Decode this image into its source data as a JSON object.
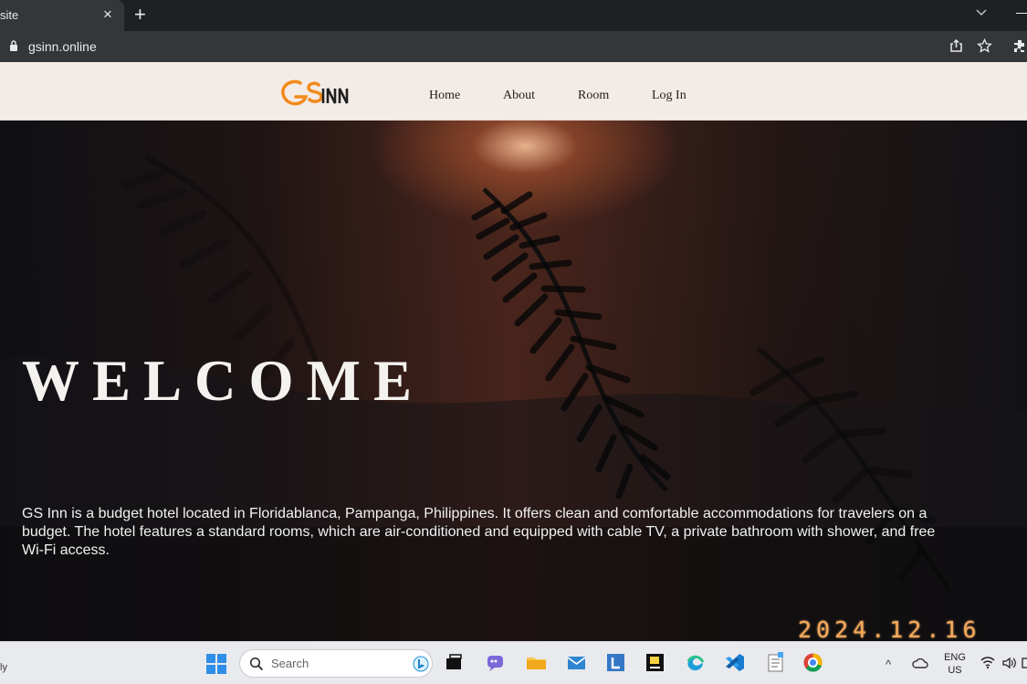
{
  "browser": {
    "tab_title": "site",
    "tab_close": "×",
    "new_tab": "+",
    "url": "gsinn.online"
  },
  "site": {
    "logo_text": "GS INN",
    "nav": [
      "Home",
      "About",
      "Room",
      "Log In"
    ],
    "hero_title": "WELCOME",
    "hero_description": "GS Inn is a budget hotel located in Floridablanca, Pampanga, Philippines. It offers clean and comfortable accommodations for travelers on a budget. The hotel features a standard rooms, which are air-conditioned and equipped with cable TV, a private bathroom with shower, and free Wi-Fi access."
  },
  "overlay": {
    "date_stamp": "2024.12.16"
  },
  "taskbar": {
    "left_text": "ly",
    "search_placeholder": "Search",
    "tray_chevron": "^",
    "language": {
      "line1": "ENG",
      "line2": "US"
    },
    "apps": [
      "task-view",
      "chat",
      "file-explorer",
      "mail",
      "l-app",
      "pycharm",
      "edge",
      "vscode",
      "notepad",
      "chrome"
    ]
  },
  "colors": {
    "nav_background": "#f3ebe6",
    "logo_orange": "#f28a1a",
    "date_stamp": "#f3a85b",
    "taskbar": "#e9eaee"
  },
  "icons": [
    "lock-icon",
    "share-icon",
    "star-icon",
    "extensions-icon",
    "windows-start-icon",
    "search-icon",
    "bing-icon",
    "wifi-icon",
    "volume-icon"
  ]
}
